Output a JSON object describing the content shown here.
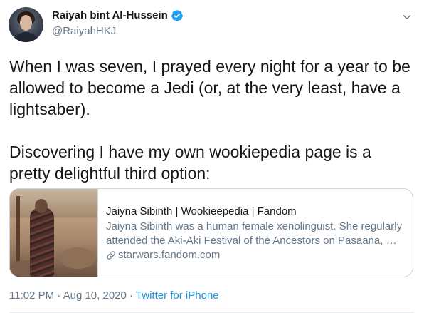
{
  "author": {
    "display_name": "Raiyah bint Al-Hussein",
    "handle": "@RaiyahHKJ",
    "verified": true
  },
  "tweet": {
    "paragraphs": [
      "When I was seven, I prayed every night for a year to be allowed to become a Jedi (or, at the very least, have a lightsaber).",
      "Discovering I have my own wookiepedia page is a pretty delightful third option:"
    ]
  },
  "card": {
    "title": "Jaiyna Sibinth | Wookieepedia | Fandom",
    "description": "Jaiyna Sibinth was a human female xenolinguist. She regularly attended the Aki-Aki Festival of the Ancestors on Pasaana, …",
    "domain": "starwars.fandom.com"
  },
  "meta": {
    "time": "11:02 PM",
    "separator_1": " · ",
    "date": "Aug 10, 2020",
    "separator_2": " · ",
    "source": "Twitter for iPhone"
  },
  "icons": {
    "verified": "verified-badge-icon",
    "menu": "chevron-down-icon",
    "link": "link-icon"
  },
  "colors": {
    "accent": "#1b95e0",
    "verified": "#1da1f2",
    "text": "#14171a",
    "secondary": "#657786",
    "border": "#ccd6dd"
  }
}
